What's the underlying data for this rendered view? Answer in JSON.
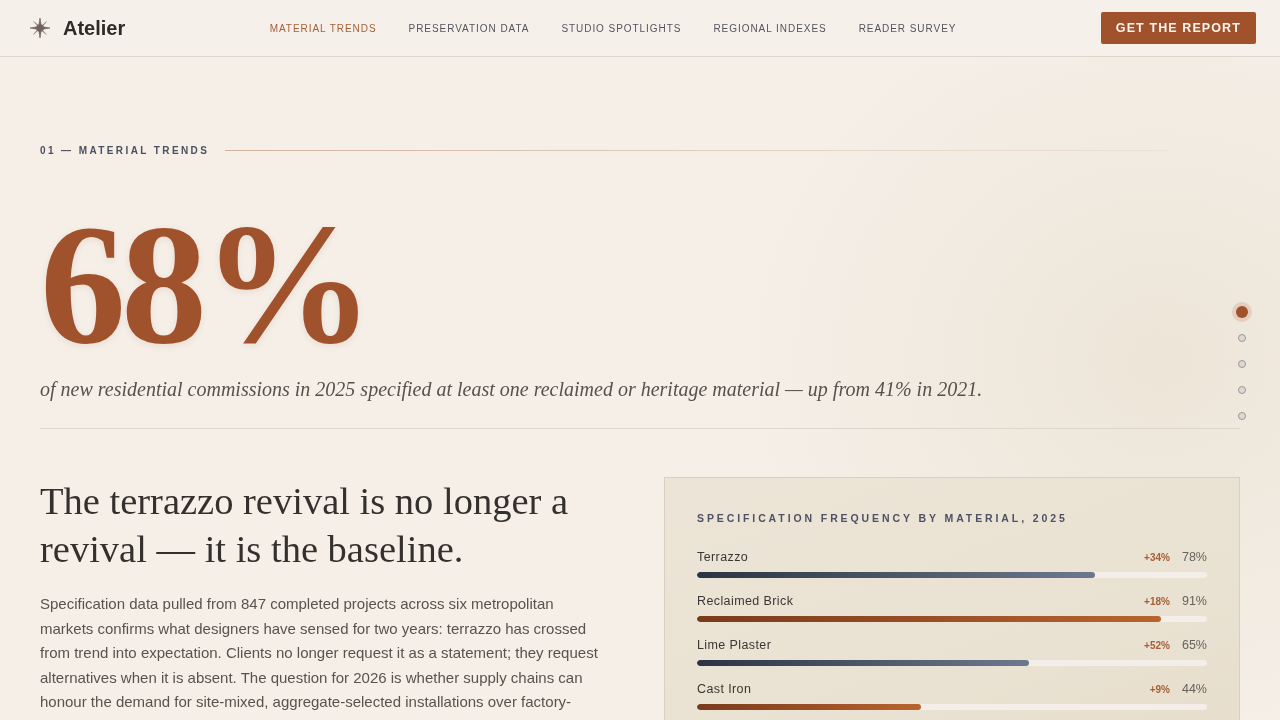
{
  "header": {
    "brand": "Atelier",
    "nav": [
      {
        "label": "MATERIAL TRENDS",
        "selected": true
      },
      {
        "label": "PRESERVATION DATA",
        "selected": false
      },
      {
        "label": "STUDIO SPOTLIGHTS",
        "selected": false
      },
      {
        "label": "REGIONAL INDEXES",
        "selected": false
      },
      {
        "label": "READER SURVEY",
        "selected": false
      }
    ],
    "cta": "GET THE REPORT"
  },
  "section": {
    "label": "01 — MATERIAL TRENDS",
    "stat": "68%",
    "stat_caption": "of new residential commissions in 2025 specified at least one reclaimed or heritage material — up from 41% in 2021.",
    "dots": [
      {
        "selected": true
      },
      {
        "selected": false
      },
      {
        "selected": false
      },
      {
        "selected": false
      },
      {
        "selected": false
      }
    ]
  },
  "article": {
    "heading": "The terrazzo revival is no longer a revival — it is the baseline.",
    "body": "Specification data pulled from 847 completed projects across six metropolitan markets confirms what designers have sensed for two years: terrazzo has crossed from trend into expectation. Clients no longer request it as a statement; they request alternatives when it is absent. The question for 2026 is whether supply chains can honour the demand for site-mixed, aggregate-selected installations over factory-"
  },
  "chart_card": {
    "title": "SPECIFICATION FREQUENCY BY MATERIAL, 2025",
    "rows": [
      {
        "name": "Terrazzo",
        "kind": "slate",
        "change": "+34%",
        "value": "78%",
        "level": 0.78
      },
      {
        "name": "Reclaimed Brick",
        "kind": "rust",
        "change": "+18%",
        "value": "91%",
        "level": 0.91
      },
      {
        "name": "Lime Plaster",
        "kind": "slate",
        "change": "+52%",
        "value": "65%",
        "level": 0.65
      },
      {
        "name": "Cast Iron",
        "kind": "rust",
        "change": "+9%",
        "value": "44%",
        "level": 0.44
      }
    ]
  }
}
